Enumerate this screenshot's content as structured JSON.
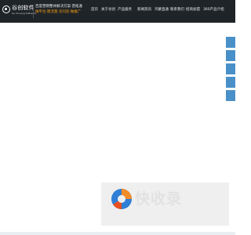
{
  "header": {
    "logo": {
      "name": "谷创软件",
      "subtitle": "Gu Chuang Software"
    },
    "slogan": {
      "line1": "百度营销整体解决方案·晋拓通",
      "line2": "做平台·建流量·买问答·做推广"
    },
    "nav": [
      {
        "label": "首页"
      },
      {
        "label": "关于谷创"
      },
      {
        "label": "产品服务"
      },
      {
        "label": "新闻资讯"
      },
      {
        "label": "鸿蒙直通"
      },
      {
        "label": "联系我们"
      },
      {
        "label": "招商加盟"
      },
      {
        "label": "360产品介绍"
      }
    ]
  },
  "side_tabs": [
    {
      "icon": "side-tab"
    },
    {
      "icon": "side-tab"
    },
    {
      "icon": "side-tab"
    },
    {
      "icon": "side-tab"
    },
    {
      "icon": "side-tab"
    }
  ],
  "watermark": {
    "text": "快收录"
  },
  "colors": {
    "header_bg": "#1f2428",
    "side_tab": "#4a90c8",
    "slogan_accent": "#f39c12"
  }
}
